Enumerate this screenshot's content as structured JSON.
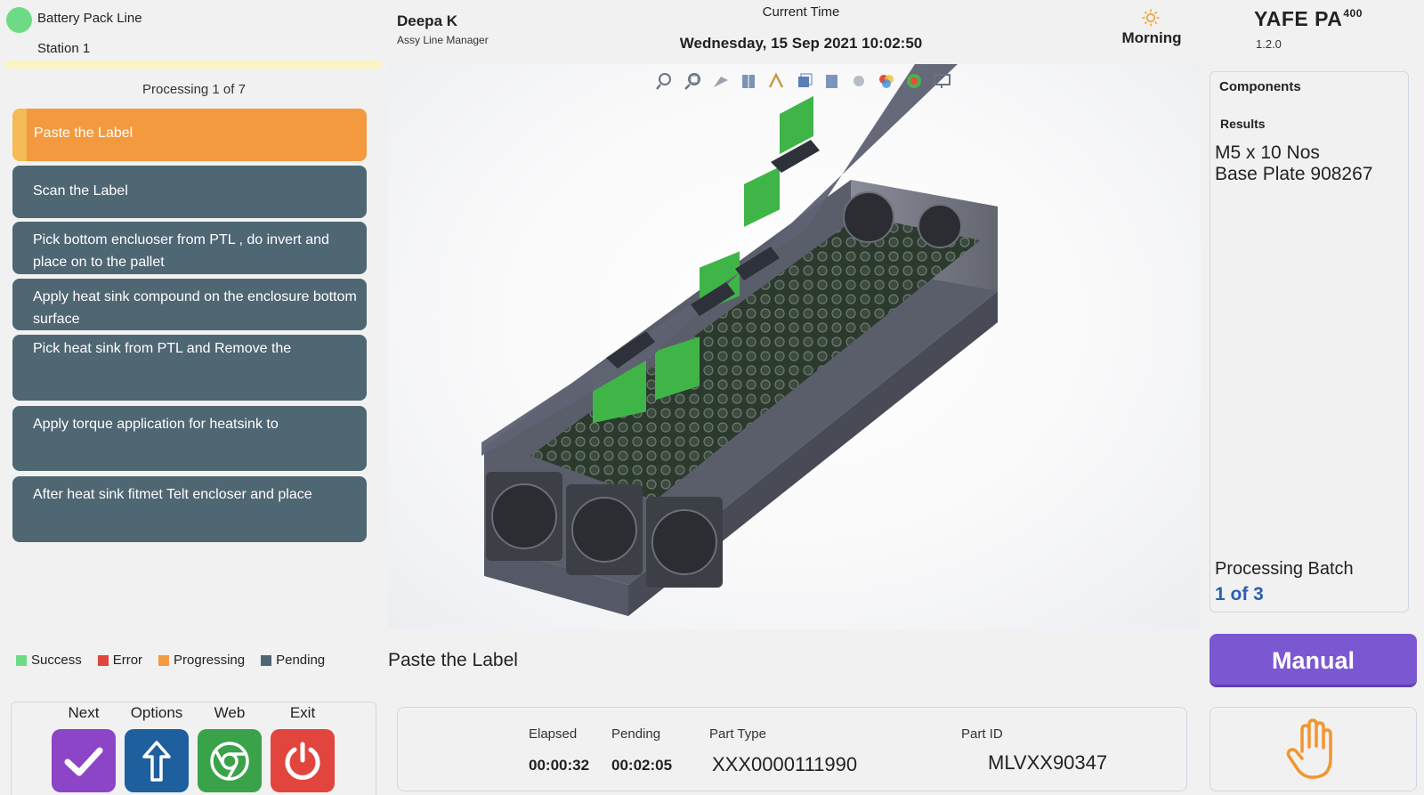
{
  "header": {
    "line_name": "Battery Pack Line",
    "station": "Station 1",
    "user_name": "Deepa K",
    "user_role": "Assy Line Manager",
    "time_label": "Current Time",
    "time_value": "Wednesday, 15 Sep 2021 10:02:50",
    "shift": "Morning",
    "brand": "YAFE PA",
    "brand_sup": "400",
    "version": "1.2.0"
  },
  "steps": {
    "processing_count": "Processing 1 of 7",
    "items": [
      {
        "label": "Paste the Label",
        "status": "progressing"
      },
      {
        "label": "Scan the Label",
        "status": "pending"
      },
      {
        "label": "Pick bottom encluoser from PTL , do invert and place on to the pallet",
        "status": "pending"
      },
      {
        "label": "Apply heat sink compound on the enclosure bottom surface",
        "status": "pending"
      },
      {
        "label": "Pick heat sink from PTL and Remove the",
        "status": "pending"
      },
      {
        "label": "Apply torque application for heatsink to",
        "status": "pending"
      },
      {
        "label": "After  heat sink fitmet Telt encloser and place",
        "status": "pending"
      }
    ]
  },
  "legend": {
    "success": "Success",
    "error": "Error",
    "progressing": "Progressing",
    "pending": "Pending"
  },
  "colors": {
    "success": "#6ddb86",
    "error": "#e0463c",
    "progressing": "#f39a3e",
    "pending": "#4f6673",
    "manual": "#7b57d1",
    "next": "#8c45c7",
    "options": "#1e5f9e",
    "web": "#3aa34a",
    "exit": "#e2453d"
  },
  "controls": {
    "next_label": "Next",
    "options_label": "Options",
    "web_label": "Web",
    "exit_label": "Exit"
  },
  "viewer": {
    "toolbar_icons": [
      "zoom-to-fit-icon",
      "zoom-area-icon",
      "previous-view-icon",
      "section-view-icon",
      "dynamic-annotation-icon",
      "view-orientation-icon",
      "display-style-icon",
      "hide-show-icon",
      "edit-appearance-icon",
      "apply-scene-icon",
      "view-settings-icon"
    ],
    "current_step": "Paste the Label"
  },
  "right_panel": {
    "title": "Components",
    "results_label": "Results",
    "result_lines": [
      "M5 x 10 Nos",
      "Base Plate 908267"
    ],
    "batch_label": "Processing Batch",
    "batch_value": "1 of 3",
    "manual_label": "Manual"
  },
  "info": {
    "elapsed_label": "Elapsed",
    "elapsed_value": "00:00:32",
    "pending_label": "Pending",
    "pending_value": "00:02:05",
    "part_type_label": "Part Type",
    "part_type_value": "XXX0000111990",
    "part_id_label": "Part ID",
    "part_id_value": "MLVXX90347"
  }
}
